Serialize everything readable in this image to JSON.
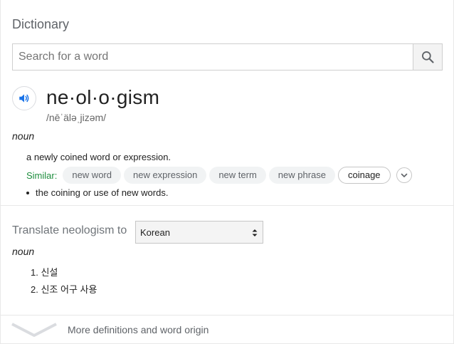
{
  "header": {
    "title": "Dictionary"
  },
  "search": {
    "placeholder": "Search for a word",
    "value": "",
    "button_icon": "search-icon"
  },
  "entry": {
    "speaker_icon": "speaker-icon",
    "headword": "ne·ol·o·gism",
    "phonetic": "/nēˈäləˌjizəm/",
    "part_of_speech": "noun",
    "definition": "a newly coined word or expression.",
    "similar_label": "Similar:",
    "similar": [
      "new word",
      "new expression",
      "new term",
      "new phrase",
      "coinage"
    ],
    "expand_icon": "chevron-down-icon",
    "secondary_definition": "the coining or use of new words."
  },
  "translate": {
    "label": "Translate neologism to",
    "selected_language": "Korean",
    "part_of_speech": "noun",
    "items": [
      "1. 신설",
      "2. 신조 어구 사용"
    ]
  },
  "footer": {
    "more_label": "More definitions and word origin",
    "chevron_icon": "chevron-down-icon"
  },
  "colors": {
    "accent_blue": "#1a73e8",
    "similar_green": "#1e8e3e",
    "chip_bg": "#f1f3f4",
    "muted_text": "#5f6368"
  }
}
